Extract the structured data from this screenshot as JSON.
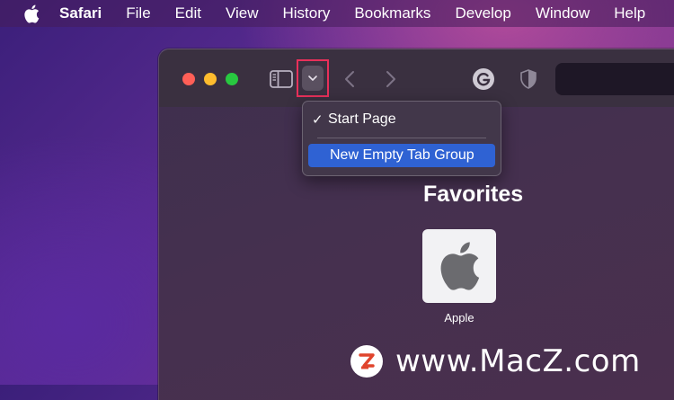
{
  "menubar": {
    "app_name": "Safari",
    "items": [
      "File",
      "Edit",
      "View",
      "History",
      "Bookmarks",
      "Develop",
      "Window",
      "Help"
    ]
  },
  "toolbar": {
    "icons": {
      "sidebar": "sidebar-icon",
      "tab_groups": "chevron-down-icon",
      "back": "chevron-left-icon",
      "forward": "chevron-right-icon",
      "grammarly": "grammarly-icon",
      "privacy": "shield-icon"
    }
  },
  "dropdown": {
    "items": [
      {
        "label": "Start Page",
        "checked": true,
        "check_mark": "✓"
      },
      {
        "label": "New Empty Tab Group",
        "highlighted": true
      }
    ]
  },
  "favorites": {
    "title": "Favorites",
    "items": [
      {
        "label": "Apple",
        "icon": "apple-icon"
      }
    ]
  },
  "watermark": {
    "text": "www.MacZ.com",
    "logo_letter": "Z"
  },
  "colors": {
    "highlight": "#2f62d3",
    "focus_outline": "#e8305a",
    "traffic_red": "#ff5f57",
    "traffic_yellow": "#febc2e",
    "traffic_green": "#28c840",
    "watermark_logo": "#e0442c"
  }
}
